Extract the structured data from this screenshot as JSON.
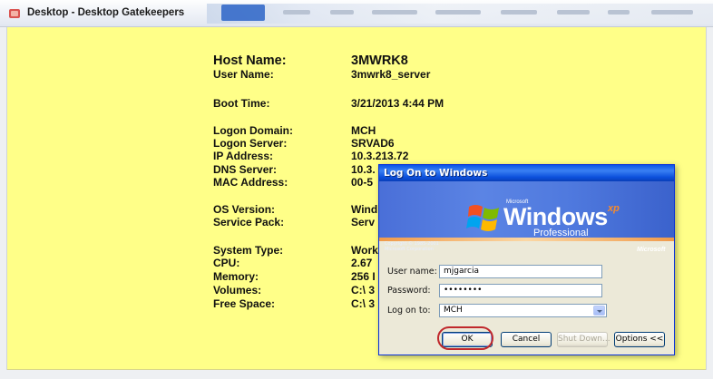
{
  "window": {
    "title": "Desktop - Desktop Gatekeepers"
  },
  "info": [
    {
      "label": "Host Name:",
      "value": "3MWRK8"
    },
    {
      "label": "User Name:",
      "value": "3mwrk8_server"
    },
    {
      "label": "Boot Time:",
      "value": "3/21/2013 4:44 PM"
    },
    {
      "label": "Logon Domain:",
      "value": "MCH"
    },
    {
      "label": "Logon Server:",
      "value": "SRVAD6"
    },
    {
      "label": "IP Address:",
      "value": "10.3.213.72"
    },
    {
      "label": "DNS Server:",
      "value": "10.3."
    },
    {
      "label": "MAC Address:",
      "value": "00-5"
    },
    {
      "label": "OS Version:",
      "value": "Wind"
    },
    {
      "label": "Service Pack:",
      "value": "Serv"
    },
    {
      "label": "System Type:",
      "value": "Work"
    },
    {
      "label": "CPU:",
      "value": "2.67"
    },
    {
      "label": "Memory:",
      "value": "256 I"
    },
    {
      "label": "Volumes:",
      "value": "C:\\ 3"
    },
    {
      "label": "Free Space:",
      "value": "C:\\ 3"
    }
  ],
  "logon_dialog": {
    "title": "Log On to Windows",
    "brand_small": "Microsoft",
    "brand_windows": "Windows",
    "brand_xp": "xp",
    "brand_edition": "Professional",
    "copyright_line1": "Copyright © 1985-2001",
    "copyright_line2": "Microsoft Corporation",
    "ms_logo": "Microsoft",
    "user_name_label": "User name:",
    "user_name_value": "mjgarcia",
    "password_label": "Password:",
    "password_value": "••••••••",
    "logon_to_label": "Log on to:",
    "logon_to_value": "MCH",
    "buttons": {
      "ok": "OK",
      "cancel": "Cancel",
      "shutdown": "Shut Down...",
      "options": "Options <<"
    }
  },
  "colors": {
    "content_background": "#ffff88",
    "xp_title_blue": "#0a55e8",
    "highlight_ring": "#c0282c"
  }
}
